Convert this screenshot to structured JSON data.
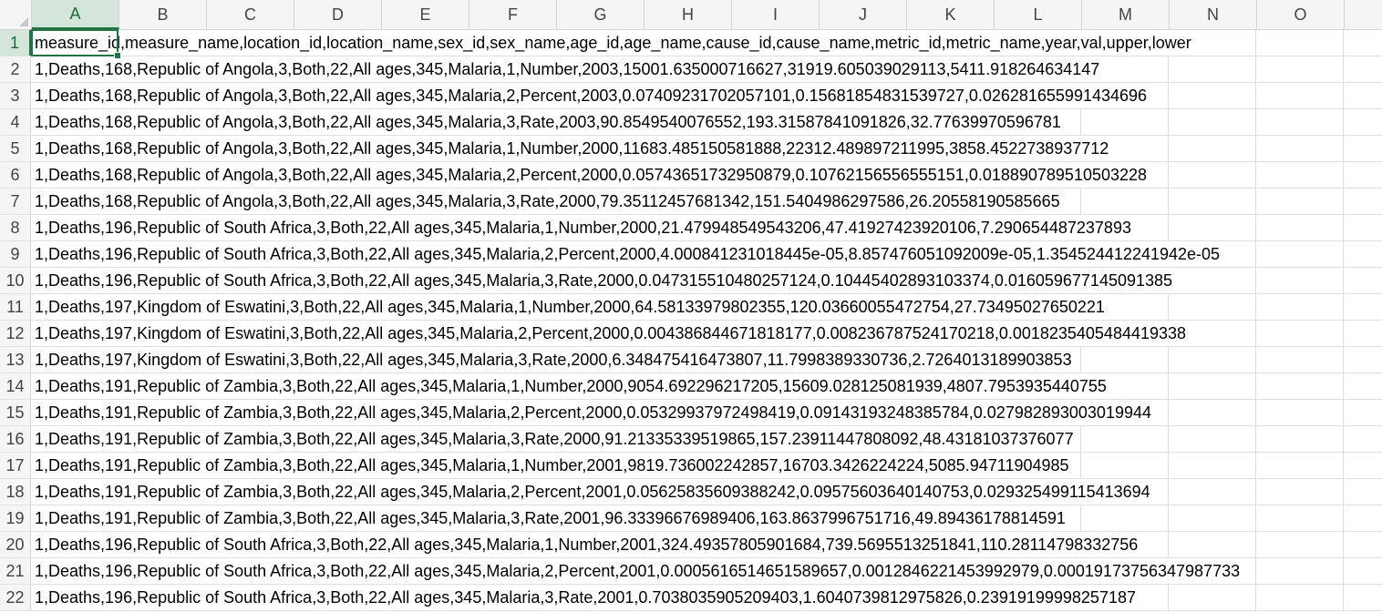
{
  "columns": [
    "A",
    "B",
    "C",
    "D",
    "E",
    "F",
    "G",
    "H",
    "I",
    "J",
    "K",
    "L",
    "M",
    "N",
    "O"
  ],
  "active_column": "A",
  "active_row": "1",
  "rows": [
    {
      "n": "1",
      "text": "measure_id,measure_name,location_id,location_name,sex_id,sex_name,age_id,age_name,cause_id,cause_name,metric_id,metric_name,year,val,upper,lower"
    },
    {
      "n": "2",
      "text": "1,Deaths,168,Republic of Angola,3,Both,22,All ages,345,Malaria,1,Number,2003,15001.635000716627,31919.605039029113,5411.918264634147"
    },
    {
      "n": "3",
      "text": "1,Deaths,168,Republic of Angola,3,Both,22,All ages,345,Malaria,2,Percent,2003,0.07409231702057101,0.15681854831539727,0.026281655991434696"
    },
    {
      "n": "4",
      "text": "1,Deaths,168,Republic of Angola,3,Both,22,All ages,345,Malaria,3,Rate,2003,90.8549540076552,193.31587841091826,32.77639970596781"
    },
    {
      "n": "5",
      "text": "1,Deaths,168,Republic of Angola,3,Both,22,All ages,345,Malaria,1,Number,2000,11683.485150581888,22312.489897211995,3858.4522738937712"
    },
    {
      "n": "6",
      "text": "1,Deaths,168,Republic of Angola,3,Both,22,All ages,345,Malaria,2,Percent,2000,0.05743651732950879,0.10762156556555151,0.018890789510503228"
    },
    {
      "n": "7",
      "text": "1,Deaths,168,Republic of Angola,3,Both,22,All ages,345,Malaria,3,Rate,2000,79.35112457681342,151.5404986297586,26.20558190585665"
    },
    {
      "n": "8",
      "text": "1,Deaths,196,Republic of South Africa,3,Both,22,All ages,345,Malaria,1,Number,2000,21.479948549543206,47.41927423920106,7.290654487237893"
    },
    {
      "n": "9",
      "text": "1,Deaths,196,Republic of South Africa,3,Both,22,All ages,345,Malaria,2,Percent,2000,4.000841231018445e-05,8.857476051092009e-05,1.354524412241942e-05"
    },
    {
      "n": "10",
      "text": "1,Deaths,196,Republic of South Africa,3,Both,22,All ages,345,Malaria,3,Rate,2000,0.047315510480257124,0.10445402893103374,0.016059677145091385"
    },
    {
      "n": "11",
      "text": "1,Deaths,197,Kingdom of Eswatini,3,Both,22,All ages,345,Malaria,1,Number,2000,64.58133979802355,120.03660055472754,27.73495027650221"
    },
    {
      "n": "12",
      "text": "1,Deaths,197,Kingdom of Eswatini,3,Both,22,All ages,345,Malaria,2,Percent,2000,0.004386844671818177,0.008236787524170218,0.0018235405484419338"
    },
    {
      "n": "13",
      "text": "1,Deaths,197,Kingdom of Eswatini,3,Both,22,All ages,345,Malaria,3,Rate,2000,6.348475416473807,11.7998389330736,2.7264013189903853"
    },
    {
      "n": "14",
      "text": "1,Deaths,191,Republic of Zambia,3,Both,22,All ages,345,Malaria,1,Number,2000,9054.692296217205,15609.028125081939,4807.7953935440755"
    },
    {
      "n": "15",
      "text": "1,Deaths,191,Republic of Zambia,3,Both,22,All ages,345,Malaria,2,Percent,2000,0.05329937972498419,0.09143193248385784,0.027982893003019944"
    },
    {
      "n": "16",
      "text": "1,Deaths,191,Republic of Zambia,3,Both,22,All ages,345,Malaria,3,Rate,2000,91.21335339519865,157.23911447808092,48.43181037376077"
    },
    {
      "n": "17",
      "text": "1,Deaths,191,Republic of Zambia,3,Both,22,All ages,345,Malaria,1,Number,2001,9819.736002242857,16703.3426224224,5085.94711904985"
    },
    {
      "n": "18",
      "text": "1,Deaths,191,Republic of Zambia,3,Both,22,All ages,345,Malaria,2,Percent,2001,0.05625835609388242,0.09575603640140753,0.029325499115413694"
    },
    {
      "n": "19",
      "text": "1,Deaths,191,Republic of Zambia,3,Both,22,All ages,345,Malaria,3,Rate,2001,96.33396676989406,163.8637996751716,49.89436178814591"
    },
    {
      "n": "20",
      "text": "1,Deaths,196,Republic of South Africa,3,Both,22,All ages,345,Malaria,1,Number,2001,324.49357805901684,739.5695513251841,110.28114798332756"
    },
    {
      "n": "21",
      "text": "1,Deaths,196,Republic of South Africa,3,Both,22,All ages,345,Malaria,2,Percent,2001,0.0005616514651589657,0.0012846221453992979,0.00019173756347987733"
    },
    {
      "n": "22",
      "text": "1,Deaths,196,Republic of South Africa,3,Both,22,All ages,345,Malaria,3,Rate,2001,0.7038035905209403,1.6040739812975826,0.23919199998257187"
    }
  ]
}
